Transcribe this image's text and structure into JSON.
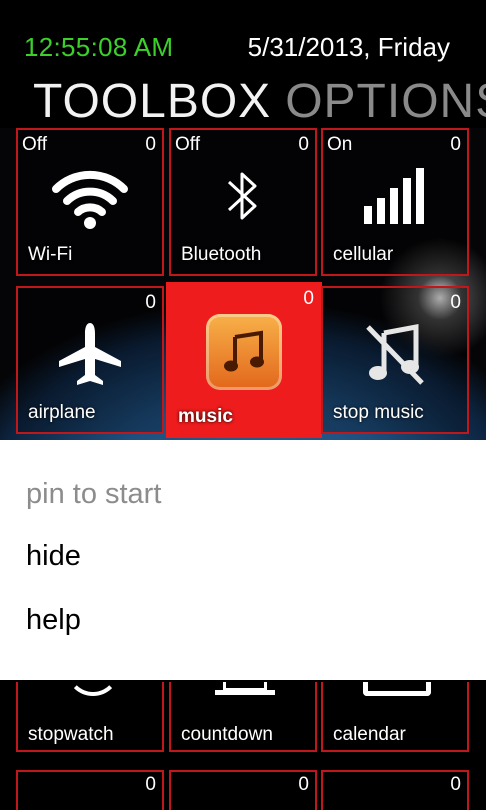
{
  "status": {
    "time": "12:55:08 AM",
    "date": "5/31/2013, Friday"
  },
  "pivot": {
    "active": "TOOLBOX",
    "inactive": "OPTIONS"
  },
  "tiles": [
    {
      "label": "Wi-Fi",
      "state": "Off",
      "count": "0",
      "icon": "wifi-icon"
    },
    {
      "label": "Bluetooth",
      "state": "Off",
      "count": "0",
      "icon": "bluetooth-icon"
    },
    {
      "label": "cellular",
      "state": "On",
      "count": "0",
      "icon": "signal-bars-icon"
    },
    {
      "label": "airplane",
      "state": "",
      "count": "0",
      "icon": "airplane-icon"
    },
    {
      "label": "music",
      "state": "",
      "count": "0",
      "icon": "music-note-icon"
    },
    {
      "label": "stop music",
      "state": "",
      "count": "0",
      "icon": "music-off-icon"
    }
  ],
  "context_menu": {
    "items": [
      "pin to start",
      "hide",
      "help"
    ]
  },
  "bottom_tiles": [
    {
      "label": "stopwatch"
    },
    {
      "label": "countdown"
    },
    {
      "label": "calendar"
    }
  ],
  "row3_tiles": [
    {
      "count": "0"
    },
    {
      "count": "0"
    },
    {
      "count": "0"
    }
  ],
  "colors": {
    "accent": "#ee1c1c",
    "tile_border": "#c0171a",
    "clock": "#3bd12a"
  }
}
